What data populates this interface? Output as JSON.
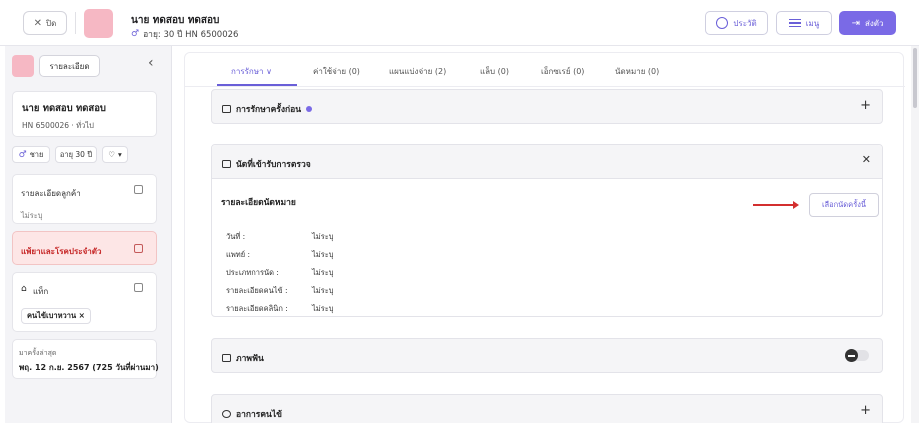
{
  "topbar": {
    "close_label": "ปิด",
    "patient_name": "นาย ทดสอบ ทดสอบ",
    "meta": "อายุ: 30 ปี HN 6500026",
    "history_label": "ประวัติ",
    "menu_label": "เมนู",
    "send_label": "ส่งตัว"
  },
  "sidebar": {
    "detail_button": "รายละเอียด",
    "name": "นาย ทดสอบ ทดสอบ",
    "hn": "HN 6500026 · ทั่วไป",
    "gender": "ชาย",
    "age": "อายุ 30 ปี",
    "customer_detail_title": "รายละเอียดลูกค้า",
    "customer_detail_value": "ไม่ระบุ",
    "allergy_title": "แพ้ยาและโรคประจำตัว",
    "tags_title": "แท็ก",
    "tag_item": "คนไข้เบาหวาน ×",
    "last_visit_label": "มาครั้งล่าสุด",
    "last_visit_value": "พฤ. 12 ก.ย. 2567 (725 วันที่ผ่านมา)"
  },
  "tabs": [
    {
      "label": "การรักษา"
    },
    {
      "label": "ค่าใช้จ่าย (0)"
    },
    {
      "label": "แผนแบ่งจ่าย (2)"
    },
    {
      "label": "แล็บ (0)"
    },
    {
      "label": "เอ็กซเรย์ (0)"
    },
    {
      "label": "นัดหมาย (0)"
    }
  ],
  "sections": {
    "previous_treatment": "การรักษาครั้งก่อน",
    "appointment_header": "นัดที่เข้ารับการตรวจ",
    "appointment_detail_title": "รายละเอียดนัดหมาย",
    "select_appointment_button": "เลือกนัดครั้งนี้",
    "dental_image": "ภาพฟัน",
    "symptoms": "อาการคนไข้"
  },
  "appointment_details": [
    {
      "label": "วันที่ :",
      "value": "ไม่ระบุ"
    },
    {
      "label": "แพทย์ :",
      "value": "ไม่ระบุ"
    },
    {
      "label": "ประเภทการนัด :",
      "value": "ไม่ระบุ"
    },
    {
      "label": "รายละเอียดคนไข้ :",
      "value": "ไม่ระบุ"
    },
    {
      "label": "รายละเอียดคลินิก :",
      "value": "ไม่ระบุ"
    }
  ],
  "colors": {
    "accent": "#7a6ae6",
    "avatar": "#f6b8c4",
    "allergy_bg": "#fde6e6",
    "allergy_text": "#c62828"
  }
}
